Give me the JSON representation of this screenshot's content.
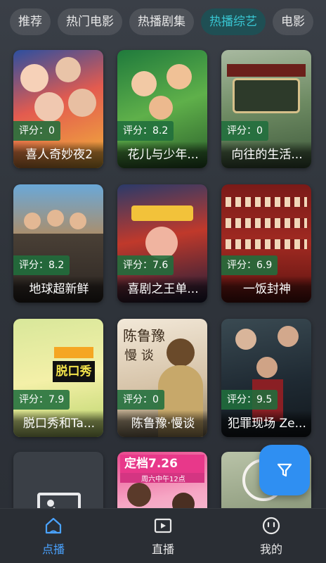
{
  "tabs": [
    {
      "label": "推荐",
      "active": false
    },
    {
      "label": "热门电影",
      "active": false
    },
    {
      "label": "热播剧集",
      "active": false
    },
    {
      "label": "热播综艺",
      "active": true
    },
    {
      "label": "电影",
      "active": false
    }
  ],
  "cards": [
    {
      "title": "喜人奇妙夜2",
      "rating": "评分：0"
    },
    {
      "title": "花儿与少年...",
      "rating": "评分：8.2"
    },
    {
      "title": "向往的生活...",
      "rating": "评分：0"
    },
    {
      "title": "地球超新鲜",
      "rating": "评分：8.2"
    },
    {
      "title": "喜剧之王单...",
      "rating": "评分：7.6"
    },
    {
      "title": "一饭封神",
      "rating": "评分：6.9"
    },
    {
      "title": "脱口秀和Ta...",
      "rating": "评分：7.9"
    },
    {
      "title": "陈鲁豫·慢谈",
      "rating": "评分：0"
    },
    {
      "title": "犯罪现场 Ze...",
      "rating": "评分：9.5"
    },
    {
      "title": "",
      "rating": ""
    },
    {
      "title": "",
      "rating": ""
    },
    {
      "title": "",
      "rating": ""
    }
  ],
  "poster_text": {
    "chenluyu_brand": "陈鲁豫",
    "chenluyu_sub": "慢 谈",
    "tuokouxiu_text": "脱口秀",
    "date_badge": "定档7.26",
    "date_sub": "周六中午12点"
  },
  "nav": [
    {
      "label": "点播",
      "icon": "home-icon",
      "active": true
    },
    {
      "label": "直播",
      "icon": "play-screen-icon",
      "active": false
    },
    {
      "label": "我的",
      "icon": "smiley-face-icon",
      "active": false
    }
  ],
  "colors": {
    "accent": "#38c6d2",
    "active_tab_bg": "#1f4f54",
    "fab": "#2f8ff2",
    "nav_active": "#4aa3ff",
    "rating_bg": "#206e3c"
  }
}
